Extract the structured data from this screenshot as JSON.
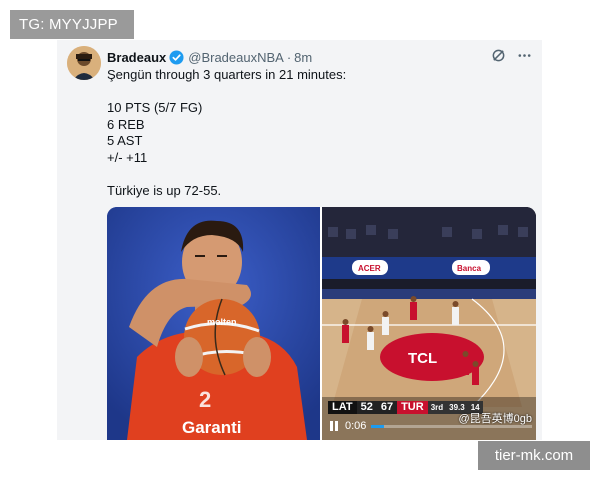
{
  "watermarks": {
    "top": "TG: MYYJJPP",
    "bottom": "tier-mk.com"
  },
  "tweet": {
    "display_name": "Bradeaux",
    "handle": "@BradeauxNBA",
    "separator": "·",
    "time": "8m",
    "verified": true,
    "icons": [
      "grok-icon",
      "more-icon"
    ],
    "text_lines": [
      "Şengün through 3 quarters in 21 minutes:",
      "",
      "10 PTS (5/7 FG)",
      "6 REB",
      "5 AST",
      "+/- +11",
      "",
      "Türkiye is up 72-55."
    ]
  },
  "media": {
    "left_photo": {
      "jersey_text": "Garanti",
      "ball_text": "molten"
    },
    "video": {
      "scoreboard": {
        "team1": "LAT",
        "score1": "52",
        "score2": "67",
        "team2": "TUR",
        "period": "3rd",
        "clock": "39.3",
        "shot_clock": "14"
      },
      "elapsed": "0:06",
      "progress": 0.08,
      "source_watermark": "@昆吾英博0gb",
      "court_logo": "TCL",
      "banner_text": "TCL"
    }
  },
  "colors": {
    "tweet_background": "#f3f4f6",
    "verified_blue": "#1d9bf0",
    "photo_background": "#2a47a8",
    "jersey_red": "#e0401f"
  }
}
